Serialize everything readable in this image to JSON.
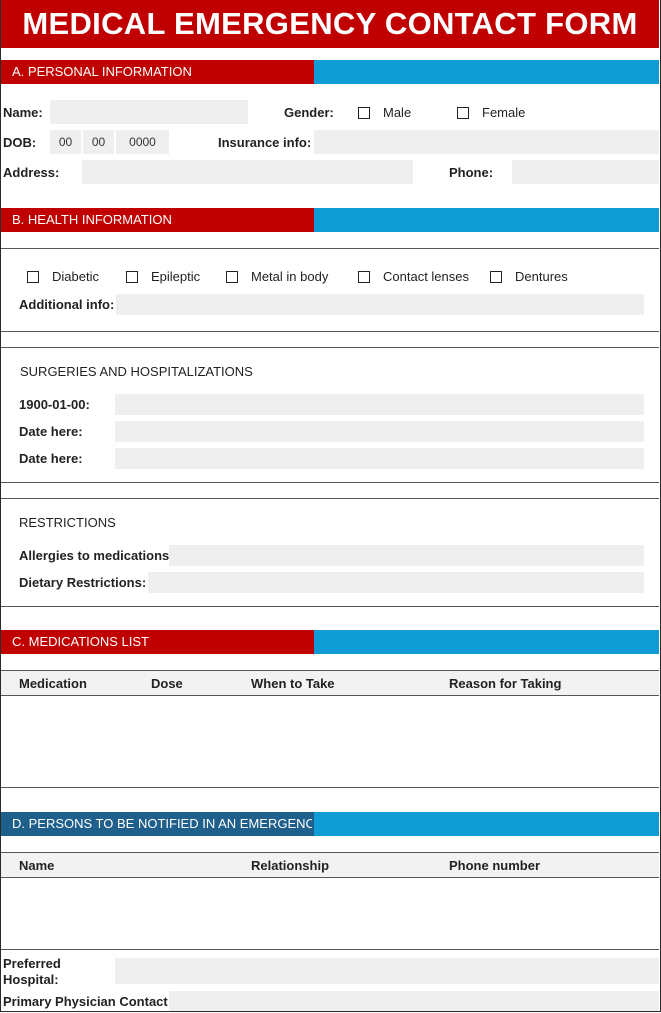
{
  "title": "MEDICAL EMERGENCY CONTACT FORM",
  "colors": {
    "brand_red": "#c00000",
    "accent_blue": "#0f9bd4",
    "field_gray": "#efefef"
  },
  "sections": {
    "personal": "A. PERSONAL INFORMATION",
    "health": "B. HEALTH INFORMATION",
    "medications": "C. MEDICATIONS LIST",
    "persons": "D. PERSONS TO BE NOTIFIED IN AN EMERGENC"
  },
  "personal": {
    "name_label": "Name:",
    "gender_label": "Gender:",
    "male_label": "Male",
    "female_label": "Female",
    "dob_label": "DOB:",
    "dob_month": "00",
    "dob_day": "00",
    "dob_year": "0000",
    "insurance_label": "Insurance info:",
    "address_label": "Address:",
    "phone_label": "Phone:"
  },
  "health": {
    "conditions": [
      "Diabetic",
      "Epileptic",
      "Metal in body",
      "Contact lenses",
      "Dentures"
    ],
    "additional_label": "Additional info:",
    "surgeries_heading": "SURGERIES AND HOSPITALIZATIONS",
    "surgery_dates": [
      "1900-01-00:",
      "Date here:",
      "Date here:"
    ],
    "restrictions_heading": "RESTRICTIONS",
    "allergies_label": "Allergies to medications",
    "dietary_label": "Dietary Restrictions:"
  },
  "medications_table": {
    "columns": [
      "Medication",
      "Dose",
      "When to Take",
      "Reason for Taking"
    ]
  },
  "persons_table": {
    "columns": [
      "Name",
      "Relationship",
      "Phone number"
    ]
  },
  "footer": {
    "hospital_label_line1": "Preferred",
    "hospital_label_line2": "Hospital:",
    "physician_label": "Primary Physician Contact"
  }
}
